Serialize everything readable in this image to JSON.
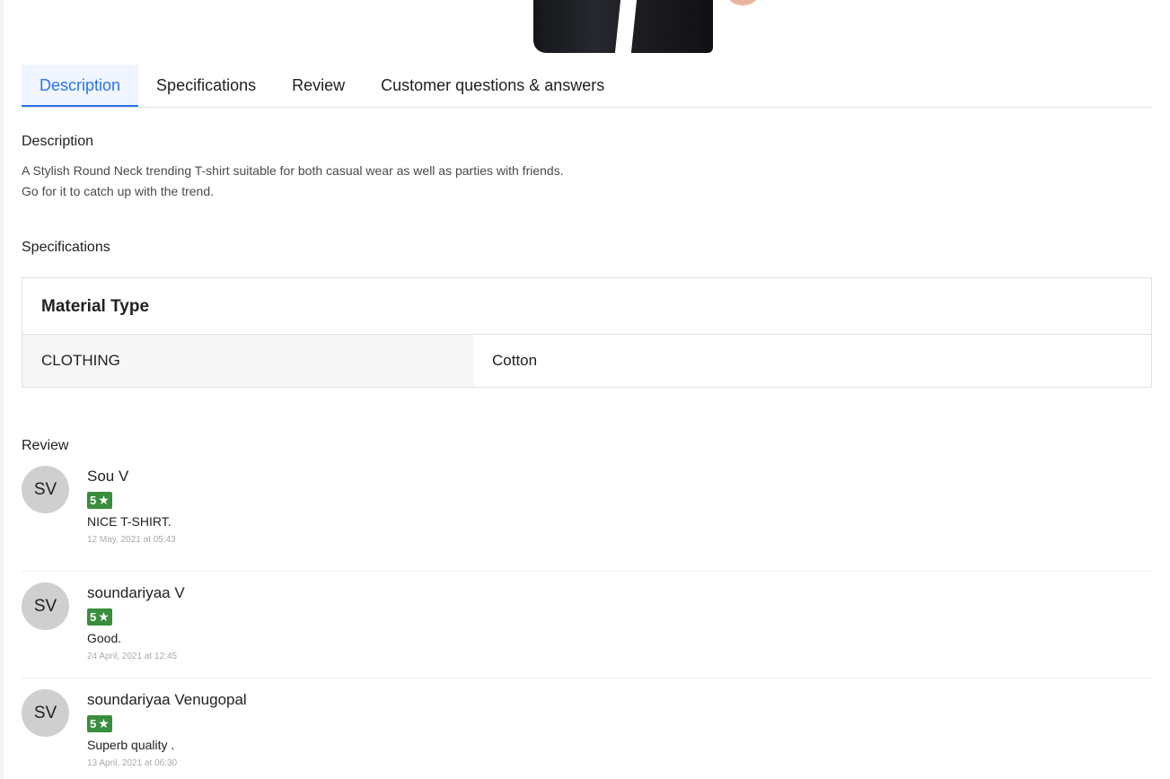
{
  "tabs": [
    {
      "label": "Description",
      "active": true
    },
    {
      "label": "Specifications",
      "active": false
    },
    {
      "label": "Review",
      "active": false
    },
    {
      "label": "Customer questions & answers",
      "active": false
    }
  ],
  "description": {
    "title": "Description",
    "lines": [
      "A Stylish Round Neck trending T-shirt suitable for both casual wear as well as parties with friends.",
      "Go for it to catch up with the trend."
    ]
  },
  "specifications": {
    "title": "Specifications",
    "group": "Material Type",
    "rows": [
      {
        "key": "CLOTHING",
        "value": "Cotton"
      }
    ]
  },
  "reviews": {
    "title": "Review",
    "items": [
      {
        "initials": "SV",
        "name": "Sou V",
        "rating": "5",
        "comment": "NICE T-SHIRT.",
        "date": "12 May, 2021 at 05:43"
      },
      {
        "initials": "SV",
        "name": "soundariyaa V",
        "rating": "5",
        "comment": "Good.",
        "date": "24 April, 2021 at 12:45"
      },
      {
        "initials": "SV",
        "name": "soundariyaa Venugopal",
        "rating": "5",
        "comment": "Superb quality .",
        "date": "13 April, 2021 at 06:30"
      }
    ]
  },
  "colors": {
    "accent": "#2874f0",
    "rating_badge": "#388e3c",
    "avatar_bg": "#cfcfcf"
  },
  "icons": {
    "rating_star": "star-icon"
  }
}
